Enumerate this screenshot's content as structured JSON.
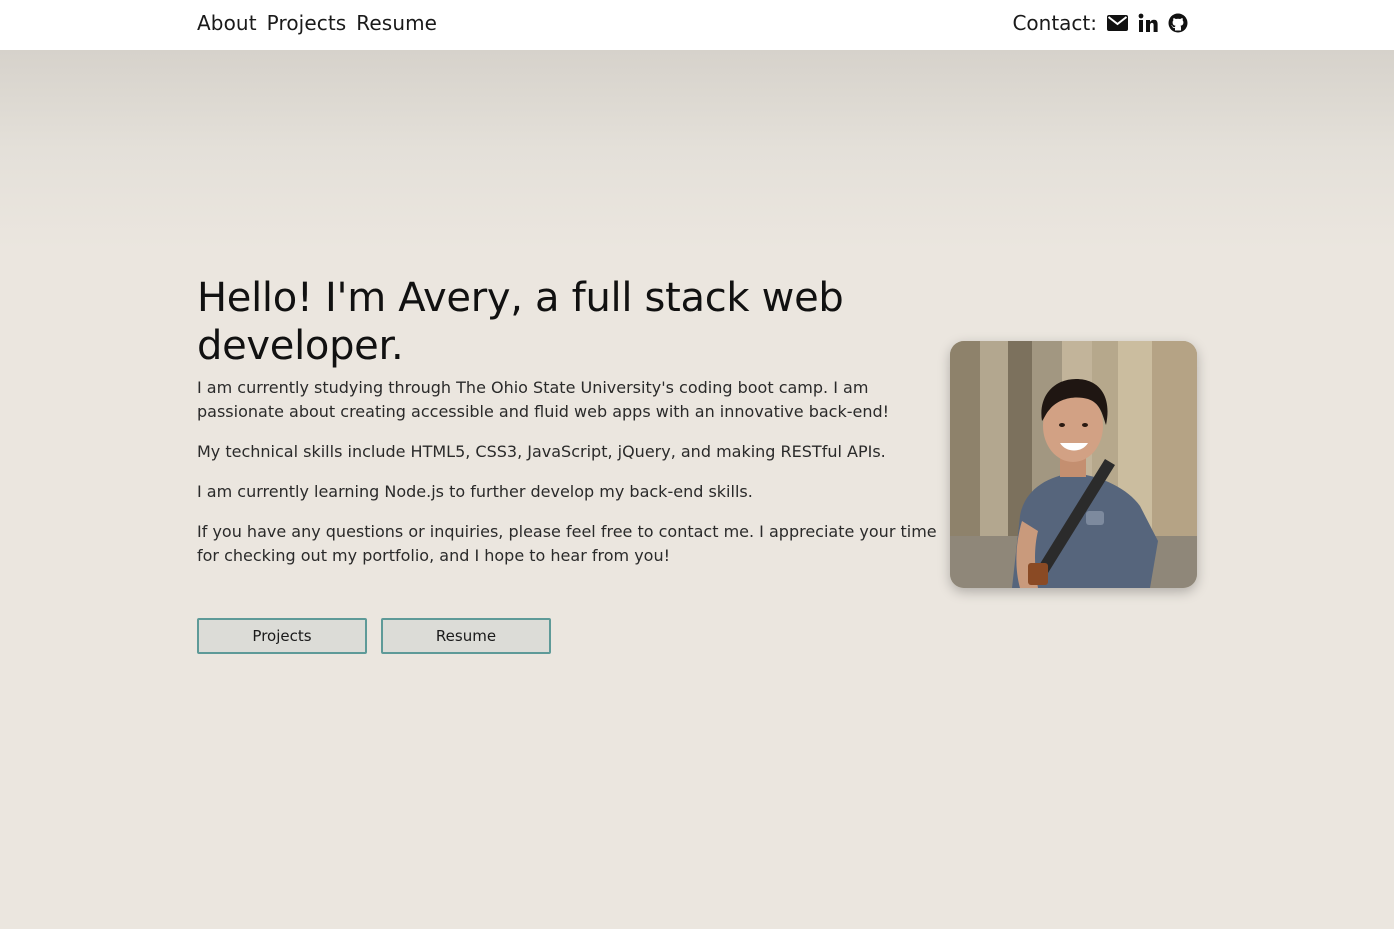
{
  "nav": {
    "links": [
      "About",
      "Projects",
      "Resume"
    ],
    "contact_label": "Contact:",
    "icons": [
      "envelope-icon",
      "linkedin-icon",
      "github-icon"
    ]
  },
  "hero": {
    "headline": "Hello! I'm Avery, a full stack web developer.",
    "paragraphs": [
      "I am currently studying through The Ohio State University's coding boot camp. I am passionate about creating accessible and fluid web apps with an innovative back-end!",
      "My technical skills include HTML5, CSS3, JavaScript, jQuery, and making RESTful APIs.",
      "I am currently learning Node.js to further develop my back-end skills.",
      "If you have any questions or inquiries, please feel free to contact me. I appreciate your time for checking out my portfolio, and I hope to hear from you!"
    ],
    "buttons": {
      "projects": "Projects",
      "resume": "Resume"
    }
  },
  "colors": {
    "background": "#ebe6df",
    "navbar": "#ffffff",
    "button_border": "#5e9a98",
    "button_fill": "#dcdcd7"
  }
}
